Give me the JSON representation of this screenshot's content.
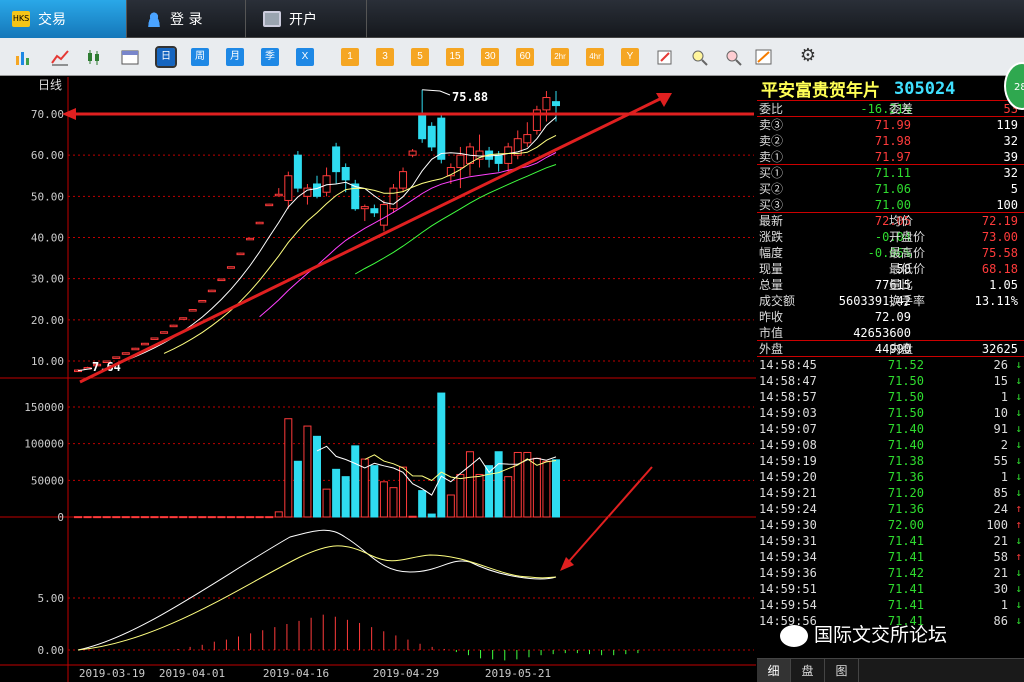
{
  "tabs": [
    {
      "label": "交易",
      "icon": "trade-icon"
    },
    {
      "label": "登  录",
      "icon": "user-icon"
    },
    {
      "label": "开户",
      "icon": "monitor-icon"
    }
  ],
  "toolbar": {
    "periods": [
      "日",
      "周",
      "月",
      "季",
      "X"
    ],
    "minutes": [
      "1",
      "3",
      "5",
      "15",
      "30",
      "60",
      "2hr",
      "4hr",
      "Y"
    ],
    "selected_period": "日",
    "left_icons": [
      "bar-chart-icon",
      "line-chart-icon",
      "candlestick-icon",
      "calendar-icon"
    ],
    "right_icons": [
      "edit-icon",
      "zoom-in-icon",
      "zoom-out-icon",
      "draw-icon",
      "gear-icon"
    ]
  },
  "chart": {
    "period_label": "日线",
    "y_ticks": [
      "70.00",
      "60.00",
      "50.00",
      "40.00",
      "30.00",
      "20.00",
      "10.00"
    ],
    "vol_ticks": [
      "150000",
      "100000",
      "50000",
      "0"
    ],
    "macd_ticks": [
      "5.00",
      "0.00"
    ],
    "x_dates": [
      "2019-03-19",
      "2019-04-01",
      "2019-04-16",
      "2019-04-29",
      "2019-05-21"
    ],
    "high_label": "75.88",
    "low_label": "7.64"
  },
  "chart_data": {
    "type": "candlestick",
    "title": "日线",
    "ylim": [
      5,
      78
    ],
    "x_labels": [
      "2019-03-19",
      "2019-04-01",
      "2019-04-16",
      "2019-04-29",
      "2019-05-21"
    ],
    "annotations": [
      "75.88",
      "7.64"
    ],
    "candles": [
      {
        "o": 7.64,
        "c": 7.8,
        "h": 8.0,
        "l": 7.64
      },
      {
        "o": 8.2,
        "c": 8.4,
        "h": 8.6,
        "l": 8.2
      },
      {
        "o": 9.0,
        "c": 9.2,
        "h": 9.3,
        "l": 9.0
      },
      {
        "o": 9.8,
        "c": 10.0,
        "h": 10.1,
        "l": 9.8
      },
      {
        "o": 10.8,
        "c": 11.0,
        "h": 11.1,
        "l": 10.8
      },
      {
        "o": 11.8,
        "c": 12.0,
        "h": 12.1,
        "l": 11.8
      },
      {
        "o": 12.9,
        "c": 13.1,
        "h": 13.2,
        "l": 12.9
      },
      {
        "o": 14.1,
        "c": 14.3,
        "h": 14.4,
        "l": 14.1
      },
      {
        "o": 15.4,
        "c": 15.6,
        "h": 15.7,
        "l": 15.4
      },
      {
        "o": 16.9,
        "c": 17.1,
        "h": 17.2,
        "l": 16.9
      },
      {
        "o": 18.5,
        "c": 18.7,
        "h": 18.8,
        "l": 18.5
      },
      {
        "o": 20.3,
        "c": 20.5,
        "h": 20.6,
        "l": 20.3
      },
      {
        "o": 22.3,
        "c": 22.5,
        "h": 22.6,
        "l": 22.3
      },
      {
        "o": 24.5,
        "c": 24.7,
        "h": 24.8,
        "l": 24.5
      },
      {
        "o": 27.0,
        "c": 27.2,
        "h": 27.3,
        "l": 27.0
      },
      {
        "o": 29.7,
        "c": 29.9,
        "h": 30.0,
        "l": 29.7
      },
      {
        "o": 32.7,
        "c": 32.9,
        "h": 33.0,
        "l": 32.7
      },
      {
        "o": 36.0,
        "c": 36.2,
        "h": 36.3,
        "l": 36.0
      },
      {
        "o": 39.6,
        "c": 39.8,
        "h": 39.9,
        "l": 39.6
      },
      {
        "o": 43.5,
        "c": 43.7,
        "h": 43.8,
        "l": 43.5
      },
      {
        "o": 47.9,
        "c": 48.1,
        "h": 48.2,
        "l": 47.9
      },
      {
        "o": 50.5,
        "c": 50.5,
        "h": 52.0,
        "l": 50.0
      },
      {
        "o": 49.0,
        "c": 55.0,
        "h": 56.0,
        "l": 47.0
      },
      {
        "o": 60.0,
        "c": 52.0,
        "h": 61.0,
        "l": 51.0
      },
      {
        "o": 50.0,
        "c": 52.0,
        "h": 53.0,
        "l": 48.0
      },
      {
        "o": 53.0,
        "c": 50.0,
        "h": 55.0,
        "l": 49.5
      },
      {
        "o": 51.0,
        "c": 55.0,
        "h": 57.0,
        "l": 50.0
      },
      {
        "o": 62.0,
        "c": 56.0,
        "h": 63.0,
        "l": 53.0
      },
      {
        "o": 57.0,
        "c": 54.0,
        "h": 58.0,
        "l": 51.0
      },
      {
        "o": 53.0,
        "c": 47.0,
        "h": 54.0,
        "l": 46.5
      },
      {
        "o": 47.0,
        "c": 47.5,
        "h": 48.0,
        "l": 44.0
      },
      {
        "o": 47.0,
        "c": 46.0,
        "h": 48.0,
        "l": 45.0
      },
      {
        "o": 43.0,
        "c": 48.0,
        "h": 49.0,
        "l": 41.5
      },
      {
        "o": 47.0,
        "c": 52.0,
        "h": 53.0,
        "l": 46.0
      },
      {
        "o": 52.0,
        "c": 56.0,
        "h": 57.0,
        "l": 51.0
      },
      {
        "o": 60.0,
        "c": 61.0,
        "h": 61.5,
        "l": 59.5
      },
      {
        "o": 70.0,
        "c": 64.0,
        "h": 75.88,
        "l": 63.0
      },
      {
        "o": 67.0,
        "c": 62.0,
        "h": 68.0,
        "l": 61.0
      },
      {
        "o": 69.0,
        "c": 59.0,
        "h": 70.0,
        "l": 58.0
      },
      {
        "o": 55.0,
        "c": 57.0,
        "h": 58.0,
        "l": 53.0
      },
      {
        "o": 57.0,
        "c": 60.0,
        "h": 62.0,
        "l": 52.0
      },
      {
        "o": 58.0,
        "c": 62.0,
        "h": 63.0,
        "l": 55.0
      },
      {
        "o": 59.0,
        "c": 61.0,
        "h": 65.0,
        "l": 57.0
      },
      {
        "o": 61.0,
        "c": 59.0,
        "h": 62.0,
        "l": 57.0
      },
      {
        "o": 60.0,
        "c": 58.0,
        "h": 61.0,
        "l": 56.0
      },
      {
        "o": 58.0,
        "c": 62.0,
        "h": 63.0,
        "l": 56.0
      },
      {
        "o": 60.0,
        "c": 64.0,
        "h": 66.0,
        "l": 59.0
      },
      {
        "o": 63.0,
        "c": 65.0,
        "h": 68.0,
        "l": 62.0
      },
      {
        "o": 66.0,
        "c": 71.0,
        "h": 72.0,
        "l": 65.0
      },
      {
        "o": 71.0,
        "c": 74.0,
        "h": 75.58,
        "l": 68.18
      },
      {
        "o": 73.0,
        "c": 72.05,
        "h": 75.58,
        "l": 68.18
      }
    ],
    "volumes": [
      500,
      500,
      500,
      500,
      500,
      500,
      500,
      500,
      500,
      500,
      500,
      500,
      500,
      500,
      500,
      500,
      500,
      500,
      500,
      500,
      500,
      7000,
      134000,
      76000,
      124000,
      110000,
      38000,
      65000,
      55000,
      97000,
      79000,
      70000,
      48000,
      40000,
      68000,
      1000,
      36000,
      4000,
      169000,
      30000,
      58000,
      89000,
      58000,
      70000,
      89000,
      55000,
      88000,
      88000,
      80000,
      76000,
      78000
    ],
    "volume_colors_note": "up bars hollow red, down bars cyan",
    "macd_hist": [
      0.1,
      0.3,
      0.5,
      0.8,
      1.0,
      1.3,
      1.6,
      1.9,
      2.2,
      2.5,
      2.8,
      3.1,
      3.4,
      3.2,
      2.9,
      2.6,
      2.2,
      1.8,
      1.4,
      1.0,
      0.6,
      0.3,
      0.1,
      -0.2,
      -0.5,
      -0.8,
      -0.9,
      -1.0,
      -0.9,
      -0.7,
      -0.5,
      -0.4,
      -0.3,
      -0.3,
      -0.4,
      -0.5,
      -0.5,
      -0.4,
      -0.3
    ]
  },
  "panel": {
    "stock_name": "平安富贵贺年片",
    "stock_code": "305024",
    "badge": "28",
    "weibi": {
      "label": "委比",
      "value": "-16.21%",
      "label2": "委差",
      "value2": "53"
    },
    "sells": [
      {
        "label": "卖③",
        "price": "71.99",
        "vol": "119"
      },
      {
        "label": "卖②",
        "price": "71.98",
        "vol": "32"
      },
      {
        "label": "卖①",
        "price": "71.97",
        "vol": "39"
      }
    ],
    "buys": [
      {
        "label": "买①",
        "price": "71.11",
        "vol": "32"
      },
      {
        "label": "买②",
        "price": "71.06",
        "vol": "5"
      },
      {
        "label": "买③",
        "price": "71.00",
        "vol": "100"
      }
    ],
    "stats": [
      {
        "l1": "最新",
        "v1": "72.05",
        "c1": "red",
        "l2": "均价",
        "v2": "72.19",
        "c2": "red"
      },
      {
        "l1": "涨跌",
        "v1": "-0.04",
        "c1": "green",
        "l2": "开盘价",
        "v2": "73.00",
        "c2": "red"
      },
      {
        "l1": "幅度",
        "v1": "-0.06%",
        "c1": "green",
        "l2": "最高价",
        "v2": "75.58",
        "c2": "red"
      },
      {
        "l1": "现量",
        "v1": "58",
        "c1": "white",
        "l2": "最低价",
        "v2": "68.18",
        "c2": "red"
      },
      {
        "l1": "总量",
        "v1": "77615",
        "c1": "white",
        "l2": "量比",
        "v2": "1.05",
        "c2": "white"
      },
      {
        "l1": "成交额",
        "v1": "5603391.42",
        "c1": "white",
        "l2": "换手率",
        "v2": "13.11%",
        "c2": "white"
      }
    ],
    "zuoshou": {
      "label": "昨收",
      "value": "72.09"
    },
    "shizhi": {
      "label": "市值",
      "value": "42653600"
    },
    "outer": {
      "label": "外盘",
      "value": "44990",
      "label2": "内盘",
      "value2": "32625"
    },
    "ticks": [
      {
        "t": "14:58:45",
        "p": "71.52",
        "v": "26",
        "dir": "down"
      },
      {
        "t": "14:58:47",
        "p": "71.50",
        "v": "15",
        "dir": "down"
      },
      {
        "t": "14:58:57",
        "p": "71.50",
        "v": "1",
        "dir": "down"
      },
      {
        "t": "14:59:03",
        "p": "71.50",
        "v": "10",
        "dir": "down"
      },
      {
        "t": "14:59:07",
        "p": "71.40",
        "v": "91",
        "dir": "down"
      },
      {
        "t": "14:59:08",
        "p": "71.40",
        "v": "2",
        "dir": "down"
      },
      {
        "t": "14:59:19",
        "p": "71.38",
        "v": "55",
        "dir": "down"
      },
      {
        "t": "14:59:20",
        "p": "71.36",
        "v": "1",
        "dir": "down"
      },
      {
        "t": "14:59:21",
        "p": "71.20",
        "v": "85",
        "dir": "down"
      },
      {
        "t": "14:59:24",
        "p": "71.36",
        "v": "24",
        "dir": "up"
      },
      {
        "t": "14:59:30",
        "p": "72.00",
        "v": "100",
        "dir": "up"
      },
      {
        "t": "14:59:31",
        "p": "71.41",
        "v": "21",
        "dir": "down"
      },
      {
        "t": "14:59:34",
        "p": "71.41",
        "v": "58",
        "dir": "up"
      },
      {
        "t": "14:59:36",
        "p": "71.42",
        "v": "21",
        "dir": "down"
      },
      {
        "t": "14:59:51",
        "p": "71.41",
        "v": "30",
        "dir": "down"
      },
      {
        "t": "14:59:54",
        "p": "71.41",
        "v": "1",
        "dir": "down"
      },
      {
        "t": "14:59:56",
        "p": "71.41",
        "v": "86",
        "dir": "down"
      }
    ],
    "bottom_tabs": [
      "细",
      "盘",
      "图"
    ]
  },
  "watermark": "国际文交所论坛",
  "colors": {
    "up": "#ff3b3b",
    "down": "#2fdcf0",
    "axis": "#c00000",
    "ma5": "#ffffff",
    "ma10": "#ffff80",
    "ma20": "#ff40ff",
    "ma60": "#40ff40"
  }
}
